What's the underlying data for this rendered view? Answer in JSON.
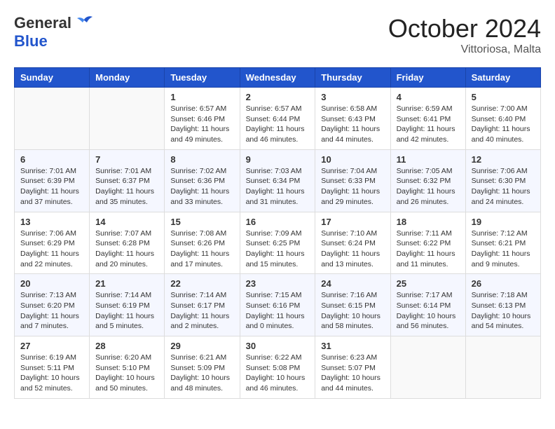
{
  "header": {
    "logo": {
      "line1": "General",
      "line2": "Blue"
    },
    "title": "October 2024",
    "location": "Vittoriosa, Malta"
  },
  "days_of_week": [
    "Sunday",
    "Monday",
    "Tuesday",
    "Wednesday",
    "Thursday",
    "Friday",
    "Saturday"
  ],
  "weeks": [
    [
      {
        "day": "",
        "info": ""
      },
      {
        "day": "",
        "info": ""
      },
      {
        "day": "1",
        "info": "Sunrise: 6:57 AM\nSunset: 6:46 PM\nDaylight: 11 hours and 49 minutes."
      },
      {
        "day": "2",
        "info": "Sunrise: 6:57 AM\nSunset: 6:44 PM\nDaylight: 11 hours and 46 minutes."
      },
      {
        "day": "3",
        "info": "Sunrise: 6:58 AM\nSunset: 6:43 PM\nDaylight: 11 hours and 44 minutes."
      },
      {
        "day": "4",
        "info": "Sunrise: 6:59 AM\nSunset: 6:41 PM\nDaylight: 11 hours and 42 minutes."
      },
      {
        "day": "5",
        "info": "Sunrise: 7:00 AM\nSunset: 6:40 PM\nDaylight: 11 hours and 40 minutes."
      }
    ],
    [
      {
        "day": "6",
        "info": "Sunrise: 7:01 AM\nSunset: 6:39 PM\nDaylight: 11 hours and 37 minutes."
      },
      {
        "day": "7",
        "info": "Sunrise: 7:01 AM\nSunset: 6:37 PM\nDaylight: 11 hours and 35 minutes."
      },
      {
        "day": "8",
        "info": "Sunrise: 7:02 AM\nSunset: 6:36 PM\nDaylight: 11 hours and 33 minutes."
      },
      {
        "day": "9",
        "info": "Sunrise: 7:03 AM\nSunset: 6:34 PM\nDaylight: 11 hours and 31 minutes."
      },
      {
        "day": "10",
        "info": "Sunrise: 7:04 AM\nSunset: 6:33 PM\nDaylight: 11 hours and 29 minutes."
      },
      {
        "day": "11",
        "info": "Sunrise: 7:05 AM\nSunset: 6:32 PM\nDaylight: 11 hours and 26 minutes."
      },
      {
        "day": "12",
        "info": "Sunrise: 7:06 AM\nSunset: 6:30 PM\nDaylight: 11 hours and 24 minutes."
      }
    ],
    [
      {
        "day": "13",
        "info": "Sunrise: 7:06 AM\nSunset: 6:29 PM\nDaylight: 11 hours and 22 minutes."
      },
      {
        "day": "14",
        "info": "Sunrise: 7:07 AM\nSunset: 6:28 PM\nDaylight: 11 hours and 20 minutes."
      },
      {
        "day": "15",
        "info": "Sunrise: 7:08 AM\nSunset: 6:26 PM\nDaylight: 11 hours and 17 minutes."
      },
      {
        "day": "16",
        "info": "Sunrise: 7:09 AM\nSunset: 6:25 PM\nDaylight: 11 hours and 15 minutes."
      },
      {
        "day": "17",
        "info": "Sunrise: 7:10 AM\nSunset: 6:24 PM\nDaylight: 11 hours and 13 minutes."
      },
      {
        "day": "18",
        "info": "Sunrise: 7:11 AM\nSunset: 6:22 PM\nDaylight: 11 hours and 11 minutes."
      },
      {
        "day": "19",
        "info": "Sunrise: 7:12 AM\nSunset: 6:21 PM\nDaylight: 11 hours and 9 minutes."
      }
    ],
    [
      {
        "day": "20",
        "info": "Sunrise: 7:13 AM\nSunset: 6:20 PM\nDaylight: 11 hours and 7 minutes."
      },
      {
        "day": "21",
        "info": "Sunrise: 7:14 AM\nSunset: 6:19 PM\nDaylight: 11 hours and 5 minutes."
      },
      {
        "day": "22",
        "info": "Sunrise: 7:14 AM\nSunset: 6:17 PM\nDaylight: 11 hours and 2 minutes."
      },
      {
        "day": "23",
        "info": "Sunrise: 7:15 AM\nSunset: 6:16 PM\nDaylight: 11 hours and 0 minutes."
      },
      {
        "day": "24",
        "info": "Sunrise: 7:16 AM\nSunset: 6:15 PM\nDaylight: 10 hours and 58 minutes."
      },
      {
        "day": "25",
        "info": "Sunrise: 7:17 AM\nSunset: 6:14 PM\nDaylight: 10 hours and 56 minutes."
      },
      {
        "day": "26",
        "info": "Sunrise: 7:18 AM\nSunset: 6:13 PM\nDaylight: 10 hours and 54 minutes."
      }
    ],
    [
      {
        "day": "27",
        "info": "Sunrise: 6:19 AM\nSunset: 5:11 PM\nDaylight: 10 hours and 52 minutes."
      },
      {
        "day": "28",
        "info": "Sunrise: 6:20 AM\nSunset: 5:10 PM\nDaylight: 10 hours and 50 minutes."
      },
      {
        "day": "29",
        "info": "Sunrise: 6:21 AM\nSunset: 5:09 PM\nDaylight: 10 hours and 48 minutes."
      },
      {
        "day": "30",
        "info": "Sunrise: 6:22 AM\nSunset: 5:08 PM\nDaylight: 10 hours and 46 minutes."
      },
      {
        "day": "31",
        "info": "Sunrise: 6:23 AM\nSunset: 5:07 PM\nDaylight: 10 hours and 44 minutes."
      },
      {
        "day": "",
        "info": ""
      },
      {
        "day": "",
        "info": ""
      }
    ]
  ]
}
